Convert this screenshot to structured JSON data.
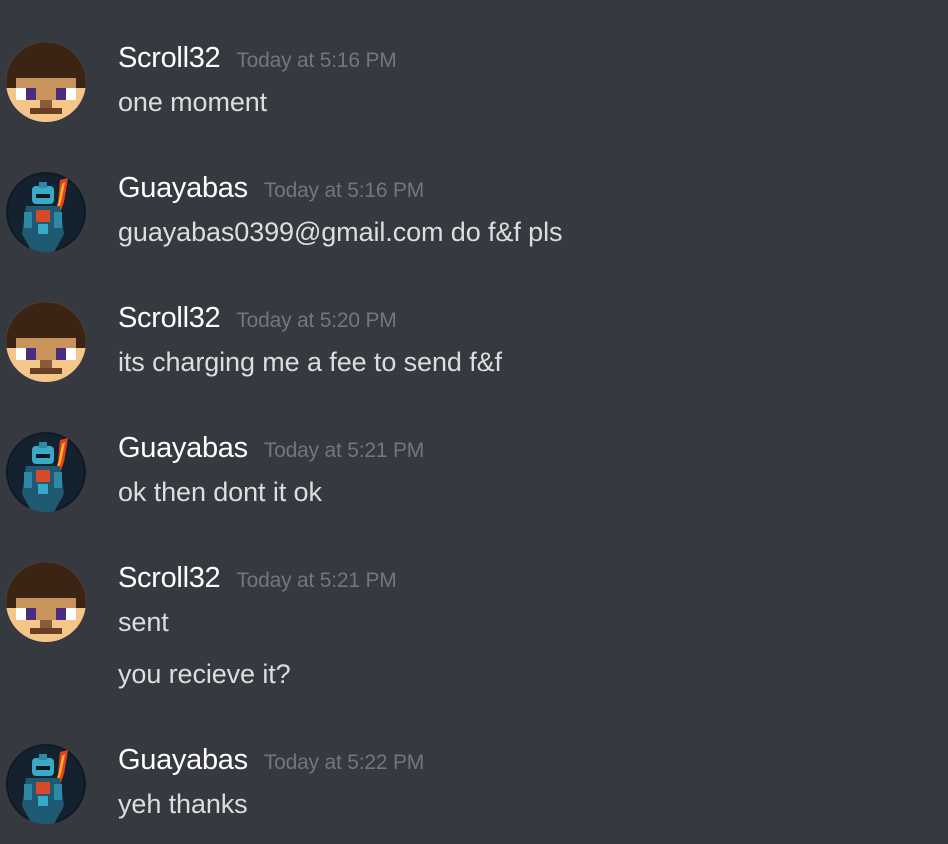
{
  "messages": [
    {
      "author": "Scroll32",
      "timestamp": "Today at 5:16 PM",
      "avatar": "steve-pixel-avatar-icon",
      "lines": [
        "one moment"
      ]
    },
    {
      "author": "Guayabas",
      "timestamp": "Today at 5:16 PM",
      "avatar": "armored-knight-avatar-icon",
      "lines": [
        "guayabas0399@gmail.com do f&f pls"
      ]
    },
    {
      "author": "Scroll32",
      "timestamp": "Today at 5:20 PM",
      "avatar": "steve-pixel-avatar-icon",
      "lines": [
        "its charging me a fee to send f&f"
      ]
    },
    {
      "author": "Guayabas",
      "timestamp": "Today at 5:21 PM",
      "avatar": "armored-knight-avatar-icon",
      "lines": [
        "ok then dont it ok"
      ]
    },
    {
      "author": "Scroll32",
      "timestamp": "Today at 5:21 PM",
      "avatar": "steve-pixel-avatar-icon",
      "lines": [
        "sent",
        "you recieve it?"
      ]
    },
    {
      "author": "Guayabas",
      "timestamp": "Today at 5:22 PM",
      "avatar": "armored-knight-avatar-icon",
      "lines": [
        "yeh thanks"
      ]
    }
  ],
  "colors": {
    "background": "#36393f",
    "username": "#ffffff",
    "timestamp": "#72767d",
    "message_text": "#dcddde"
  }
}
